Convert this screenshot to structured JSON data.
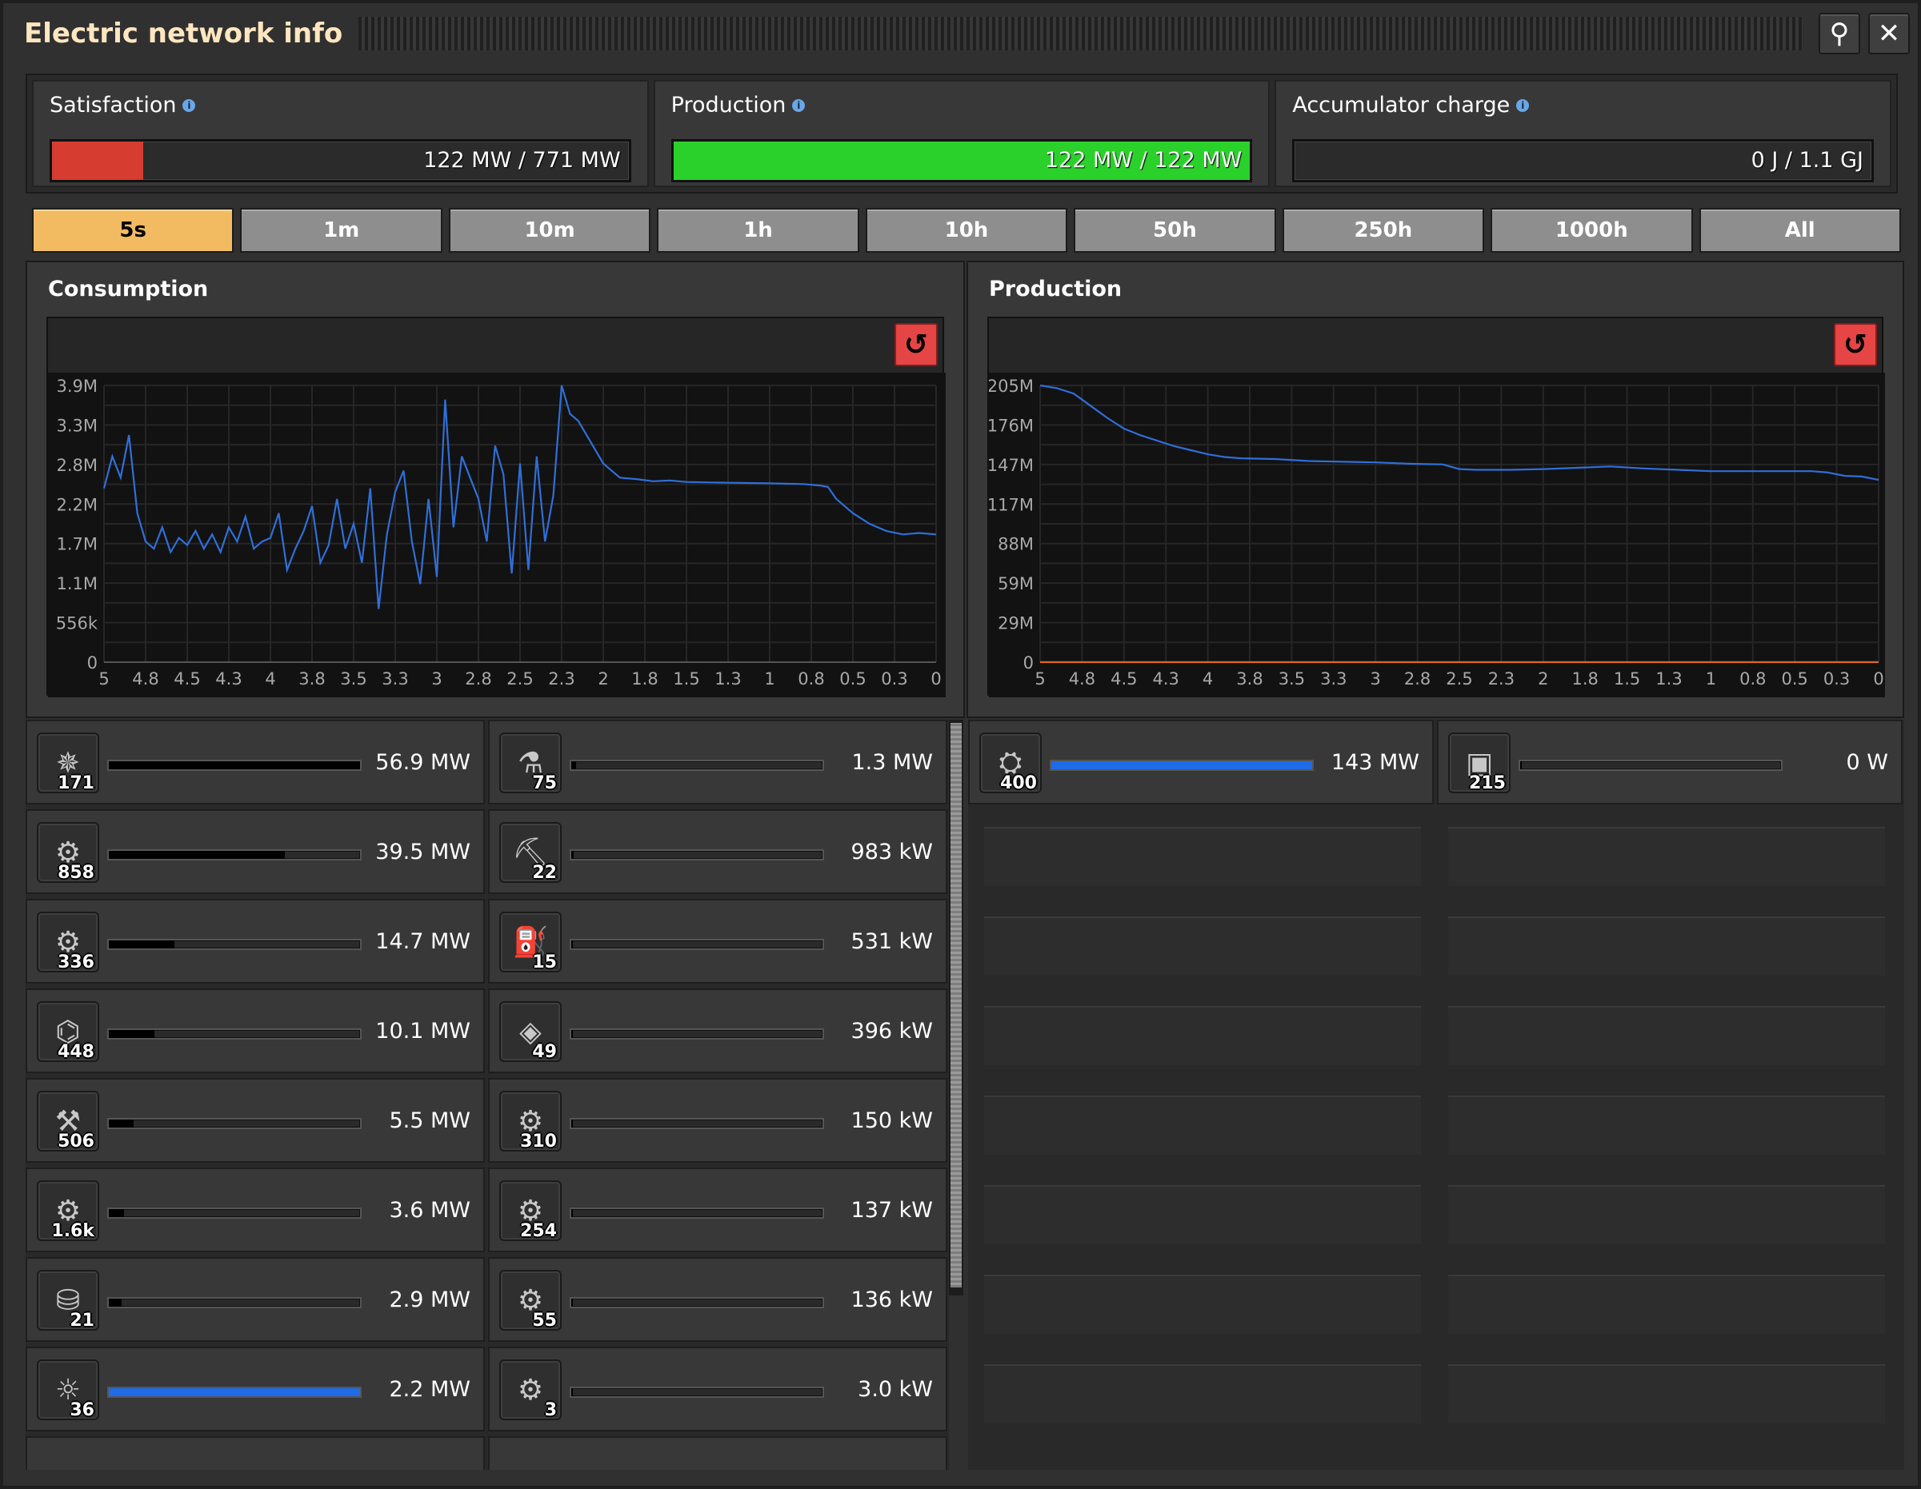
{
  "window": {
    "title": "Electric network info"
  },
  "stats": [
    {
      "label": "Satisfaction",
      "value": "122 MW / 771 MW",
      "fill": 0.158,
      "color": "#d63c30"
    },
    {
      "label": "Production",
      "value": "122 MW / 122 MW",
      "fill": 1.0,
      "color": "#2bd12b"
    },
    {
      "label": "Accumulator charge",
      "value": "0 J / 1.1 GJ",
      "fill": 0,
      "color": "#2bd12b"
    }
  ],
  "tabs": [
    "5s",
    "1m",
    "10m",
    "1h",
    "10h",
    "50h",
    "250h",
    "1000h",
    "All"
  ],
  "active_tab": "5s",
  "consumption": {
    "title": "Consumption"
  },
  "production": {
    "title": "Production"
  },
  "chart_data": [
    {
      "type": "line",
      "title": "Consumption",
      "yticks": [
        "3.9M",
        "3.3M",
        "2.8M",
        "2.2M",
        "1.7M",
        "1.1M",
        "556k",
        "0"
      ],
      "xticks": [
        "5",
        "4.8",
        "4.5",
        "4.3",
        "4",
        "3.8",
        "3.5",
        "3.3",
        "3",
        "2.8",
        "2.5",
        "2.3",
        "2",
        "1.8",
        "1.5",
        "1.3",
        "1",
        "0.8",
        "0.5",
        "0.3",
        "0"
      ],
      "ylim": [
        0,
        3900000
      ],
      "xlim": [
        5,
        0
      ],
      "grid": true,
      "series": [
        {
          "color": "#2f6fd8",
          "x": [
            5,
            4.95,
            4.9,
            4.85,
            4.8,
            4.75,
            4.7,
            4.65,
            4.6,
            4.55,
            4.5,
            4.45,
            4.4,
            4.35,
            4.3,
            4.25,
            4.2,
            4.15,
            4.1,
            4.05,
            4.0,
            3.95,
            3.9,
            3.85,
            3.8,
            3.75,
            3.7,
            3.65,
            3.6,
            3.55,
            3.5,
            3.45,
            3.4,
            3.35,
            3.3,
            3.25,
            3.2,
            3.15,
            3.1,
            3.05,
            3.0,
            2.95,
            2.9,
            2.85,
            2.8,
            2.75,
            2.7,
            2.65,
            2.6,
            2.55,
            2.5,
            2.45,
            2.4,
            2.35,
            2.3,
            2.25,
            2.2,
            2.15,
            2.1,
            2.0,
            1.9,
            1.8,
            1.7,
            1.6,
            1.5,
            1.3,
            1.0,
            0.8,
            0.75,
            0.7,
            0.65,
            0.6,
            0.5,
            0.4,
            0.3,
            0.2,
            0.1,
            0.0
          ],
          "y": [
            2450000,
            2900000,
            2600000,
            3200000,
            2100000,
            1700000,
            1600000,
            1900000,
            1550000,
            1750000,
            1650000,
            1850000,
            1600000,
            1800000,
            1550000,
            1900000,
            1700000,
            2050000,
            1600000,
            1700000,
            1750000,
            2100000,
            1300000,
            1600000,
            1850000,
            2200000,
            1400000,
            1650000,
            2300000,
            1600000,
            1950000,
            1400000,
            2450000,
            750000,
            1800000,
            2400000,
            2700000,
            1700000,
            1100000,
            2300000,
            1200000,
            3700000,
            1900000,
            2900000,
            2600000,
            2300000,
            1700000,
            3050000,
            2650000,
            1250000,
            2800000,
            1300000,
            2900000,
            1700000,
            2350000,
            3900000,
            3500000,
            3400000,
            3200000,
            2800000,
            2600000,
            2580000,
            2550000,
            2560000,
            2540000,
            2530000,
            2520000,
            2510000,
            2500000,
            2490000,
            2470000,
            2300000,
            2100000,
            1950000,
            1850000,
            1800000,
            1820000,
            1800000
          ]
        }
      ]
    },
    {
      "type": "line",
      "title": "Production",
      "yticks": [
        "205M",
        "176M",
        "147M",
        "117M",
        "88M",
        "59M",
        "29M",
        "0"
      ],
      "xticks": [
        "5",
        "4.8",
        "4.5",
        "4.3",
        "4",
        "3.8",
        "3.5",
        "3.3",
        "3",
        "2.8",
        "2.5",
        "2.3",
        "2",
        "1.8",
        "1.5",
        "1.3",
        "1",
        "0.8",
        "0.5",
        "0.3",
        "0"
      ],
      "ylim": [
        0,
        205000000
      ],
      "xlim": [
        5,
        0
      ],
      "grid": true,
      "series": [
        {
          "color": "#2f6fd8",
          "x": [
            5,
            4.9,
            4.8,
            4.7,
            4.6,
            4.5,
            4.4,
            4.3,
            4.2,
            4.1,
            4.0,
            3.9,
            3.8,
            3.6,
            3.4,
            3.2,
            3.0,
            2.8,
            2.6,
            2.5,
            2.4,
            2.2,
            2.0,
            1.8,
            1.6,
            1.4,
            1.2,
            1.0,
            0.8,
            0.6,
            0.4,
            0.3,
            0.2,
            0.1,
            0.0
          ],
          "y": [
            205000000,
            203000000,
            199000000,
            190000000,
            181000000,
            173000000,
            168000000,
            164000000,
            160000000,
            157000000,
            154000000,
            152000000,
            151000000,
            150500000,
            149000000,
            148500000,
            148000000,
            147000000,
            146500000,
            143000000,
            142500000,
            142500000,
            143000000,
            144000000,
            145000000,
            143500000,
            142500000,
            141500000,
            141500000,
            141500000,
            141500000,
            140500000,
            138000000,
            137500000,
            135000000
          ]
        },
        {
          "color": "#e06a1a",
          "x": [
            5,
            0
          ],
          "y": [
            0,
            0
          ]
        }
      ]
    }
  ],
  "consumers": [
    {
      "icon": "radar-icon",
      "glyph": "✵",
      "count": "171",
      "value": "56.9 MW",
      "fill": 1.0,
      "blue": false
    },
    {
      "icon": "chemical-plant-icon",
      "glyph": "⚗",
      "count": "75",
      "value": "1.3 MW",
      "fill": 0.02,
      "blue": false
    },
    {
      "icon": "inserter-icon",
      "glyph": "⚙",
      "count": "858",
      "value": "39.5 MW",
      "fill": 0.7,
      "blue": false
    },
    {
      "icon": "offshore-pump-icon",
      "glyph": "⛏",
      "count": "22",
      "value": "983 kW",
      "fill": 0.01,
      "blue": false
    },
    {
      "icon": "assembler-icon",
      "glyph": "⚙",
      "count": "336",
      "value": "14.7 MW",
      "fill": 0.26,
      "blue": false
    },
    {
      "icon": "pumpjack-icon",
      "glyph": "⛽",
      "count": "15",
      "value": "531 kW",
      "fill": 0.0,
      "blue": false
    },
    {
      "icon": "lab-icon",
      "glyph": "⌬",
      "count": "448",
      "value": "10.1 MW",
      "fill": 0.18,
      "blue": false
    },
    {
      "icon": "roboport-icon",
      "glyph": "◈",
      "count": "49",
      "value": "396 kW",
      "fill": 0.0,
      "blue": false
    },
    {
      "icon": "mining-drill-icon",
      "glyph": "⚒",
      "count": "506",
      "value": "5.5 MW",
      "fill": 0.1,
      "blue": false
    },
    {
      "icon": "long-inserter-icon",
      "glyph": "⚙",
      "count": "310",
      "value": "150 kW",
      "fill": 0.0,
      "blue": false
    },
    {
      "icon": "fast-inserter-icon",
      "glyph": "⚙",
      "count": "1.6k",
      "value": "3.6 MW",
      "fill": 0.06,
      "blue": false
    },
    {
      "icon": "filter-inserter-icon",
      "glyph": "⚙",
      "count": "254",
      "value": "137 kW",
      "fill": 0.0,
      "blue": false
    },
    {
      "icon": "oil-refinery-icon",
      "glyph": "⛁",
      "count": "21",
      "value": "2.9 MW",
      "fill": 0.05,
      "blue": false
    },
    {
      "icon": "beacon-icon",
      "glyph": "⚙",
      "count": "55",
      "value": "136 kW",
      "fill": 0.0,
      "blue": false
    },
    {
      "icon": "lamp-icon",
      "glyph": "☼",
      "count": "36",
      "value": "2.2 MW",
      "fill": 1.0,
      "blue": true
    },
    {
      "icon": "stack-inserter-icon",
      "glyph": "⚙",
      "count": "3",
      "value": "3.0 kW",
      "fill": 0.0,
      "blue": false
    }
  ],
  "producers": [
    {
      "icon": "steam-engine-icon",
      "glyph": "⛭",
      "count": "400",
      "value": "143 MW",
      "fill": 1.0,
      "blue": true
    },
    {
      "icon": "accumulator-icon",
      "glyph": "▣",
      "count": "215",
      "value": "0 W",
      "fill": 0.0,
      "blue": false
    }
  ]
}
